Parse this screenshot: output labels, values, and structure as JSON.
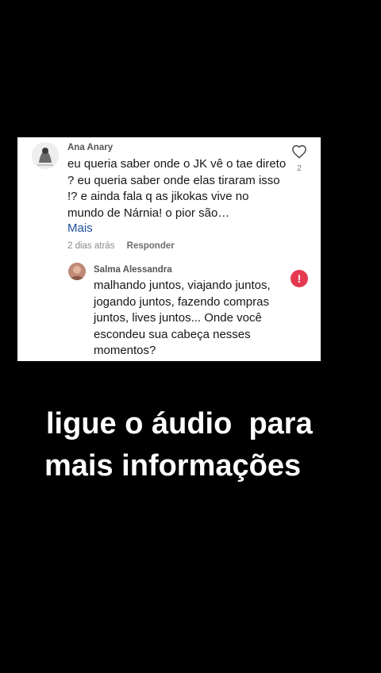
{
  "comment": {
    "author": "Ana Anary",
    "text": "eu queria saber onde o JK vê o tae direto ? eu queria saber onde elas tiraram isso !? e ainda fala q as jikokas vive no mundo de Nárnia! o pior são…",
    "more_label": "Mais",
    "time": "2 dias atrás",
    "reply_label": "Responder",
    "like_icon": "heart-outline-icon",
    "like_count": "2"
  },
  "reply": {
    "author": "Salma Alessandra",
    "text": "malhando juntos, viajando juntos, jogando juntos, fazendo compras juntos, lives juntos... Onde você escondeu sua cabeça nesses momentos?",
    "alert_icon": "exclamation-alert-icon",
    "alert_symbol": "!",
    "alert_color": "#e53950"
  },
  "caption": {
    "line1": "ligue o áudio  para",
    "line2": "mais informações"
  },
  "colors": {
    "background": "#000000",
    "card": "#ffffff",
    "link": "#1b4f9c"
  }
}
